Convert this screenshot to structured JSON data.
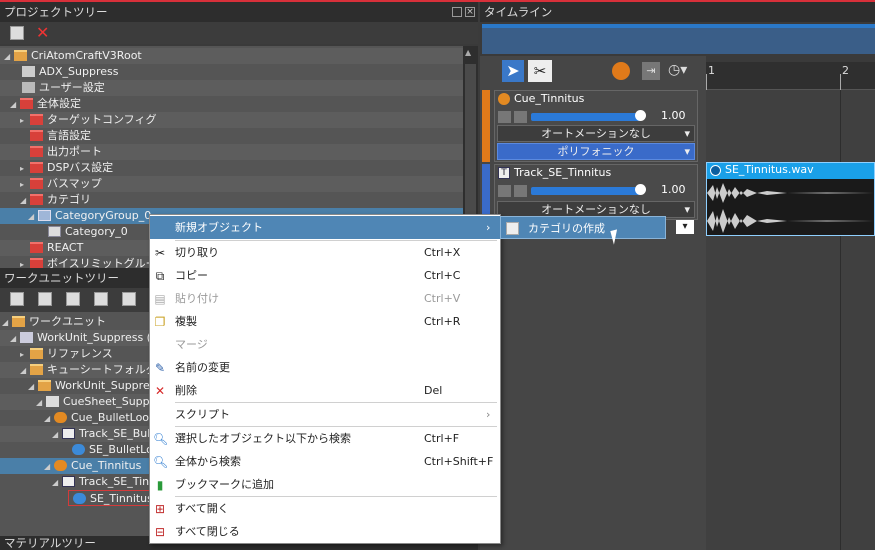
{
  "project_tree": {
    "title": "プロジェクトツリー",
    "items": [
      {
        "label": "CriAtomCraftV3Root"
      },
      {
        "label": "ADX_Suppress"
      },
      {
        "label": "ユーザー設定"
      },
      {
        "label": "全体設定"
      },
      {
        "label": "ターゲットコンフィグ"
      },
      {
        "label": "言語設定"
      },
      {
        "label": "出力ポート"
      },
      {
        "label": "DSPバス設定"
      },
      {
        "label": "バスマップ"
      },
      {
        "label": "カテゴリ"
      },
      {
        "label": "CategoryGroup_0"
      },
      {
        "label": "Category_0"
      },
      {
        "label": "REACT"
      },
      {
        "label": "ボイスリミットグループ"
      }
    ]
  },
  "workunit_tree": {
    "title": "ワークユニットツリー",
    "items": [
      {
        "label": "ワークユニット"
      },
      {
        "label": "WorkUnit_Suppress (WorkUnit_Suppress.atmcunit)"
      },
      {
        "label": "リファレンス"
      },
      {
        "label": "キューシートフォルダー"
      },
      {
        "label": "WorkUnit_Suppress"
      },
      {
        "label": "CueSheet_Suppress"
      },
      {
        "label": "Cue_BulletLoop"
      },
      {
        "label": "Track_SE_BulletLoop"
      },
      {
        "label": "SE_BulletLoop.wav"
      },
      {
        "label": "Cue_Tinnitus"
      },
      {
        "label": "Track_SE_Tinnitus"
      },
      {
        "label": "SE_Tinnitus.wav"
      }
    ]
  },
  "material_tree": {
    "title": "マテリアルツリー"
  },
  "timeline": {
    "title": "タイムライン",
    "ruler": [
      "1",
      "2"
    ],
    "cue": {
      "name": "Cue_Tinnitus",
      "volume": "1.00",
      "automation": "オートメーションなし",
      "mode": "ポリフォニック"
    },
    "track": {
      "name": "Track_SE_Tinnitus",
      "volume": "1.00",
      "automation": "オートメーションなし"
    },
    "waveform": {
      "label": "SE_Tinnitus.wav"
    }
  },
  "context_menu": {
    "items": [
      {
        "label": "新規オブジェクト",
        "shortcut": ""
      },
      {
        "label": "切り取り",
        "shortcut": "Ctrl+X"
      },
      {
        "label": "コピー",
        "shortcut": "Ctrl+C"
      },
      {
        "label": "貼り付け",
        "shortcut": "Ctrl+V"
      },
      {
        "label": "複製",
        "shortcut": "Ctrl+R"
      },
      {
        "label": "マージ",
        "shortcut": ""
      },
      {
        "label": "名前の変更",
        "shortcut": ""
      },
      {
        "label": "削除",
        "shortcut": "Del"
      },
      {
        "label": "スクリプト",
        "shortcut": ""
      },
      {
        "label": "選択したオブジェクト以下から検索",
        "shortcut": "Ctrl+F"
      },
      {
        "label": "全体から検索",
        "shortcut": "Ctrl+Shift+F"
      },
      {
        "label": "ブックマークに追加",
        "shortcut": ""
      },
      {
        "label": "すべて開く",
        "shortcut": ""
      },
      {
        "label": "すべて閉じる",
        "shortcut": ""
      }
    ]
  },
  "submenu": {
    "item": "カテゴリの作成"
  },
  "colors": {
    "accent": "#4f86b5",
    "cue_orange": "#e07a1a",
    "track_blue": "#3a6bc9",
    "waveform_bg": "#1aa0e8"
  }
}
